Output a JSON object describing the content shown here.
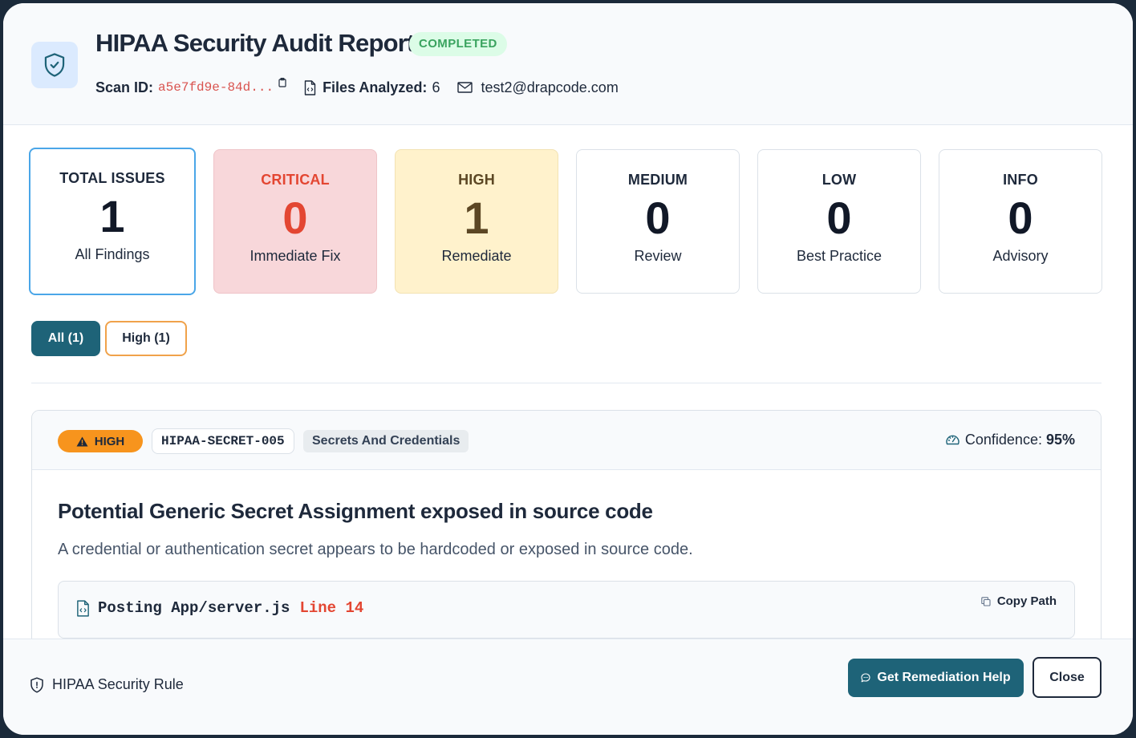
{
  "header": {
    "title": "HIPAA Security Audit Report",
    "status": "COMPLETED",
    "scan_id_label": "Scan ID:",
    "scan_id": "a5e7fd9e-84d...",
    "files_label": "Files Analyzed:",
    "files_count": "6",
    "email": "test2@drapcode.com"
  },
  "cards": [
    {
      "label": "TOTAL ISSUES",
      "count": "1",
      "sub": "All Findings"
    },
    {
      "label": "CRITICAL",
      "count": "0",
      "sub": "Immediate Fix"
    },
    {
      "label": "HIGH",
      "count": "1",
      "sub": "Remediate"
    },
    {
      "label": "MEDIUM",
      "count": "0",
      "sub": "Review"
    },
    {
      "label": "LOW",
      "count": "0",
      "sub": "Best Practice"
    },
    {
      "label": "INFO",
      "count": "0",
      "sub": "Advisory"
    }
  ],
  "filters": {
    "all": "All (1)",
    "high": "High (1)"
  },
  "finding": {
    "severity": "HIGH",
    "rule_id": "HIPAA-SECRET-005",
    "category": "Secrets And Credentials",
    "confidence_label": "Confidence:",
    "confidence_value": "95%",
    "title": "Potential Generic Secret Assignment exposed in source code",
    "description": "A credential or authentication secret appears to be hardcoded or exposed in source code.",
    "file": "Posting App/server.js",
    "line": "Line 14",
    "copy_path": "Copy Path"
  },
  "footer": {
    "rule": "HIPAA Security Rule",
    "help_button": "Get Remediation Help",
    "close_button": "Close"
  },
  "colors": {
    "primary": "#1e6378",
    "critical": "#e34632",
    "high_badge": "#f7941d",
    "completed": "#3aa35f",
    "active_border": "#4aa6e8"
  },
  "icons": {
    "logo": "shield-check-icon",
    "copy": "copy-icon",
    "file": "file-code-icon",
    "email": "mail-icon",
    "warning": "warning-triangle-icon",
    "gauge": "gauge-icon",
    "chat": "chat-icon"
  }
}
